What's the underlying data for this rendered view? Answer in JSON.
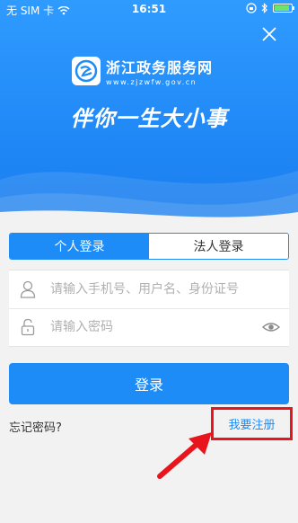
{
  "status_bar": {
    "carrier": "无 SIM 卡",
    "time": "16:51"
  },
  "hero": {
    "logo_title": "浙江政务服务网",
    "logo_url": "www.zjzwfw.gov.cn",
    "slogan": "伴你一生大小事"
  },
  "tabs": [
    {
      "label": "个人登录",
      "active": true
    },
    {
      "label": "法人登录",
      "active": false
    }
  ],
  "form": {
    "username_placeholder": "请输入手机号、用户名、身份证号",
    "password_placeholder": "请输入密码"
  },
  "actions": {
    "login_label": "登录",
    "forgot_label": "忘记密码?",
    "register_label": "我要注册"
  },
  "colors": {
    "primary": "#1e8cf7",
    "highlight": "#e8161c"
  },
  "icons": [
    "wifi-icon",
    "lock-rotation-icon",
    "bluetooth-icon",
    "battery-icon",
    "close-icon",
    "logo-icon",
    "user-icon",
    "lock-icon",
    "eye-icon",
    "red-arrow-annotation"
  ]
}
